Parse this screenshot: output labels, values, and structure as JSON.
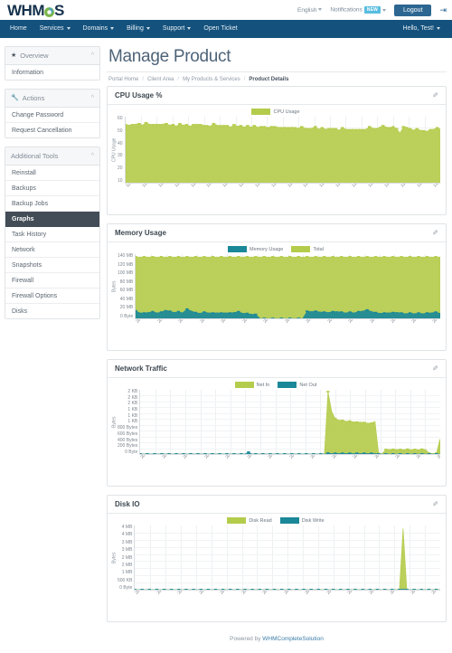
{
  "topbar": {
    "logo_text_left": "WHM",
    "logo_text_right": "S",
    "logo_icon": "gear-icon",
    "language": "English",
    "notifications": "Notifications",
    "notifications_badge": "NEW",
    "logout_label": "Logout",
    "logout_icon": "sign-out-icon"
  },
  "navbar": {
    "items": [
      {
        "label": "Home",
        "caret": false
      },
      {
        "label": "Services",
        "caret": true
      },
      {
        "label": "Domains",
        "caret": true
      },
      {
        "label": "Billing",
        "caret": true
      },
      {
        "label": "Support",
        "caret": true
      },
      {
        "label": "Open Ticket",
        "caret": false
      }
    ],
    "account": "Hello, Test!"
  },
  "sidebar": {
    "sections": [
      {
        "title": "Overview",
        "icon": "star-icon",
        "items": [
          "Information"
        ]
      },
      {
        "title": "Actions",
        "icon": "wrench-icon",
        "items": [
          "Change Password",
          "Request Cancellation"
        ]
      },
      {
        "title": "Additional Tools",
        "icon": "",
        "items": [
          "Reinstall",
          "Backups",
          "Backup Jobs",
          "Graphs",
          "Task History",
          "Network",
          "Snapshots",
          "Firewall",
          "Firewall Options",
          "Disks"
        ],
        "active": "Graphs"
      }
    ]
  },
  "main": {
    "title": "Manage Product",
    "breadcrumb": [
      "Portal Home",
      "Client Area",
      "My Products & Services",
      "Product Details"
    ]
  },
  "colors": {
    "green": "#b4cc4c",
    "green_line": "#9dba2e",
    "teal": "#1a8898",
    "teal_line": "#147380",
    "navy": "#14527d",
    "accent_blue": "#2c6691",
    "active_gray": "#434d57"
  },
  "footer": {
    "text": "Powered by ",
    "link": "WHMCompleteSolution"
  },
  "chart_data": [
    {
      "id": "cpu",
      "panel_title": "CPU Usage %",
      "type": "area",
      "title": "CPU Usage %",
      "ylabel": "CPU Usage",
      "xlabel": "",
      "grid": true,
      "legend_position": "top-center",
      "legend": [
        {
          "name": "CPU Usage",
          "color": "#b4cc4c"
        }
      ],
      "ylim": [
        0,
        65
      ],
      "yticks": [
        10,
        20,
        30,
        40,
        50,
        60
      ],
      "ytick_labels": [
        "10",
        "20",
        "30",
        "40",
        "50",
        "60"
      ],
      "x": [
        "12:59:00",
        "13:02:00",
        "13:05:00",
        "13:08:00",
        "13:11:00",
        "13:14:00",
        "13:17:00",
        "13:20:00",
        "13:23:00",
        "13:26:00",
        "13:29:00",
        "13:32:00",
        "13:35:00",
        "13:38:00",
        "13:41:00",
        "13:44:00",
        "13:47:00",
        "13:50:00",
        "13:53:00",
        "13:56:00",
        "13:59:00",
        "14:02:00",
        "14:05:00",
        "14:08:00"
      ],
      "series": [
        {
          "name": "CPU Usage",
          "color": "#b4cc4c",
          "values": [
            57,
            57,
            57,
            58,
            58,
            57,
            59,
            58,
            57,
            58,
            57,
            58,
            58,
            57,
            57,
            56,
            58,
            57,
            57,
            56,
            57,
            58,
            57,
            57,
            56,
            56,
            58,
            57,
            56,
            57,
            56,
            55,
            57,
            56,
            56,
            55,
            56,
            55,
            56,
            55,
            55,
            56,
            54,
            56,
            55,
            55,
            54,
            55,
            54,
            55,
            54,
            54,
            55,
            54,
            53,
            54,
            55,
            53,
            54,
            53,
            53,
            54,
            53,
            52,
            54,
            53,
            52,
            53,
            52,
            53,
            52,
            53,
            55,
            54,
            53,
            55,
            56,
            55,
            54,
            56,
            53,
            49,
            55,
            55,
            53,
            52,
            53,
            52,
            51,
            51,
            52,
            53,
            54,
            53
          ]
        }
      ]
    },
    {
      "id": "memory",
      "panel_title": "Memory Usage",
      "type": "area",
      "title": "Memory Usage",
      "ylabel": "Bytes",
      "xlabel": "",
      "grid": true,
      "legend_position": "top-center",
      "legend": [
        {
          "name": "Memory Usage",
          "color": "#1a8898"
        },
        {
          "name": "Total",
          "color": "#b4cc4c"
        }
      ],
      "ylim": [
        0,
        145
      ],
      "yticks": [
        0,
        20,
        40,
        60,
        80,
        100,
        120,
        140
      ],
      "ytick_labels": [
        "0 Byte",
        "20 MB",
        "40 MB",
        "60 MB",
        "80 MB",
        "100 MB",
        "120 MB",
        "140 MB"
      ],
      "x": [
        "2019-08-05",
        "2019-08-06",
        "2019-08-06",
        "2019-08-07",
        "2019-08-07",
        "2019-08-08",
        "2019-08-08",
        "2019-08-09",
        "2019-08-09",
        "2019-08-10",
        "2019-08-10",
        "2019-08-11",
        "2019-08-11",
        "2019-08-12",
        "2019-08-12",
        "2019-08-13",
        "2019-08-13",
        "2019-08-14"
      ],
      "series": [
        {
          "name": "Total",
          "color": "#b4cc4c",
          "values": [
            139,
            139,
            139,
            139,
            139,
            139,
            139,
            139,
            139,
            139,
            139,
            139,
            139,
            139,
            139,
            139,
            139,
            139,
            139,
            139,
            139,
            139,
            139,
            139,
            139,
            139,
            139,
            139,
            139,
            139,
            139,
            139,
            139,
            139,
            139,
            139,
            139,
            139,
            139,
            139,
            139,
            139,
            139,
            139,
            139,
            139,
            139,
            139,
            139,
            139,
            139,
            139,
            139,
            139,
            139,
            139,
            139,
            139,
            139,
            139,
            139,
            139,
            139,
            139,
            139,
            139,
            139,
            139,
            139,
            139,
            139,
            139
          ]
        },
        {
          "name": "Memory Usage",
          "color": "#1a8898",
          "values": [
            17,
            13,
            12,
            14,
            15,
            13,
            14,
            19,
            16,
            14,
            15,
            13,
            21,
            17,
            13,
            12,
            14,
            13,
            12,
            13,
            12,
            13,
            12,
            14,
            15,
            12,
            11,
            10,
            9,
            0,
            0,
            0,
            0,
            0,
            0,
            0,
            0,
            0,
            0,
            0,
            16,
            16,
            16,
            15,
            14,
            14,
            15,
            16,
            14,
            13,
            14,
            13,
            15,
            17,
            19,
            16,
            13,
            12,
            12,
            13,
            13,
            14,
            12,
            11,
            12,
            11,
            12,
            11,
            12,
            13,
            14,
            12
          ]
        }
      ]
    },
    {
      "id": "network",
      "panel_title": "Network Traffic",
      "type": "area",
      "title": "Network Traffic",
      "ylabel": "Bytes",
      "xlabel": "",
      "grid": true,
      "legend_position": "top-center",
      "legend": [
        {
          "name": "Net In",
          "color": "#b4cc4c"
        },
        {
          "name": "Net Out",
          "color": "#1a8898"
        }
      ],
      "ylim": [
        0,
        2400
      ],
      "yticks": [
        0,
        200,
        400,
        600,
        800,
        1024,
        1200,
        1400,
        1800,
        2000,
        2300
      ],
      "ytick_labels": [
        "0 Byte",
        "200 Bytes",
        "400 Bytes",
        "600 Bytes",
        "800 Bytes",
        "1 KB",
        "1 KB",
        "1 KB",
        "2 KB",
        "2 KB",
        "2 KB"
      ],
      "x": [
        "2019-08-05",
        "2019-08-06",
        "2019-08-06",
        "2019-08-07",
        "2019-08-07",
        "2019-08-08",
        "2019-08-08",
        "2019-08-09",
        "2019-08-09",
        "2019-08-10",
        "2019-08-10",
        "2019-08-11",
        "2019-08-11",
        "2019-08-12",
        "2019-08-12",
        "2019-08-13",
        "2019-08-13",
        "2019-08-14"
      ],
      "series": [
        {
          "name": "Net In",
          "color": "#b4cc4c",
          "values": [
            5,
            5,
            5,
            5,
            5,
            5,
            5,
            5,
            5,
            5,
            5,
            5,
            5,
            5,
            5,
            5,
            5,
            5,
            5,
            5,
            5,
            5,
            5,
            5,
            5,
            5,
            5,
            5,
            5,
            5,
            5,
            5,
            5,
            5,
            5,
            5,
            5,
            5,
            5,
            5,
            5,
            5,
            5,
            5,
            5,
            5,
            5,
            5,
            5,
            5,
            5,
            5,
            2330,
            1600,
            1320,
            1280,
            1255,
            1240,
            1230,
            1215,
            1190,
            1205,
            1175,
            1165,
            1150,
            1230,
            20,
            20,
            170,
            185,
            175,
            180,
            170,
            175,
            180,
            175,
            170,
            175,
            180,
            175,
            30,
            30,
            30,
            560
          ]
        },
        {
          "name": "Net Out",
          "color": "#1a8898",
          "values": [
            4,
            4,
            4,
            4,
            4,
            4,
            4,
            4,
            4,
            4,
            4,
            4,
            4,
            4,
            4,
            4,
            4,
            4,
            4,
            4,
            4,
            4,
            4,
            4,
            4,
            4,
            4,
            4,
            4,
            4,
            70,
            4,
            4,
            4,
            4,
            4,
            4,
            4,
            4,
            4,
            4,
            4,
            4,
            4,
            4,
            4,
            4,
            4,
            4,
            4,
            4,
            4,
            35,
            30,
            28,
            28,
            28,
            28,
            28,
            28,
            28,
            28,
            28,
            28,
            28,
            28,
            5,
            5,
            5,
            5,
            5,
            5,
            5,
            5,
            5,
            5,
            5,
            5,
            5,
            5,
            5,
            5,
            5,
            5
          ]
        }
      ]
    },
    {
      "id": "diskio",
      "panel_title": "Disk IO",
      "type": "area",
      "title": "Disk IO",
      "ylabel": "Bytes",
      "xlabel": "",
      "grid": true,
      "legend_position": "top-center",
      "legend": [
        {
          "name": "Disk Read",
          "color": "#b4cc4c"
        },
        {
          "name": "Disk Write",
          "color": "#1a8898"
        }
      ],
      "ylim": [
        0,
        4400
      ],
      "yticks": [
        0,
        500,
        1024,
        1500,
        2048,
        2500,
        3072,
        3500,
        4096
      ],
      "ytick_labels": [
        "0 Byte",
        "500 KB",
        "1 MB",
        "2 MB",
        "2 MB",
        "3 MB",
        "3 MB",
        "4 MB",
        "4 MB"
      ],
      "x": [
        "2019-08-05",
        "2019-08-06",
        "2019-08-06",
        "2019-08-07",
        "2019-08-07",
        "2019-08-08",
        "2019-08-08",
        "2019-08-09",
        "2019-08-09",
        "2019-08-10",
        "2019-08-10",
        "2019-08-11",
        "2019-08-11",
        "2019-08-12",
        "2019-08-12",
        "2019-08-13",
        "2019-08-13",
        "2019-08-14"
      ],
      "series": [
        {
          "name": "Disk Read",
          "color": "#b4cc4c",
          "values": [
            10,
            10,
            10,
            10,
            10,
            10,
            10,
            10,
            10,
            10,
            10,
            10,
            10,
            10,
            10,
            10,
            10,
            10,
            10,
            10,
            10,
            10,
            10,
            10,
            10,
            10,
            10,
            10,
            10,
            10,
            10,
            10,
            10,
            10,
            10,
            10,
            10,
            10,
            10,
            10,
            10,
            10,
            10,
            10,
            10,
            10,
            10,
            10,
            10,
            10,
            10,
            10,
            10,
            10,
            10,
            10,
            10,
            10,
            10,
            10,
            10,
            10,
            10,
            10,
            10,
            10,
            10,
            10,
            10,
            10,
            10,
            10,
            10,
            4200,
            10,
            10,
            10,
            10,
            10,
            10,
            10,
            10,
            10,
            10
          ]
        },
        {
          "name": "Disk Write",
          "color": "#1a8898",
          "values": [
            6,
            6,
            6,
            6,
            6,
            6,
            6,
            6,
            6,
            6,
            6,
            6,
            6,
            6,
            6,
            6,
            6,
            6,
            6,
            6,
            6,
            6,
            6,
            6,
            6,
            6,
            6,
            6,
            6,
            6,
            6,
            6,
            6,
            6,
            6,
            6,
            6,
            6,
            6,
            6,
            6,
            6,
            6,
            6,
            6,
            6,
            6,
            6,
            6,
            6,
            6,
            6,
            6,
            6,
            6,
            6,
            6,
            6,
            6,
            6,
            6,
            6,
            6,
            6,
            6,
            6,
            6,
            6,
            6,
            6,
            6,
            6,
            6,
            60,
            6,
            6,
            6,
            6,
            6,
            6,
            6,
            6,
            6,
            6
          ]
        }
      ]
    }
  ]
}
